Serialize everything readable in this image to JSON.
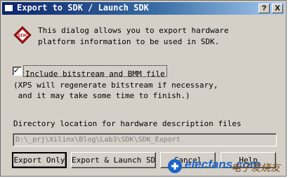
{
  "window": {
    "title": "Export to SDK / Launch SDK",
    "help_glyph": "?",
    "close_glyph": "X"
  },
  "icons": {
    "sdk_logo_text": "SDK",
    "checkbox_mark": "✓"
  },
  "description": {
    "line1": "This dialog allows you to export hardware",
    "line2": "platform information to be used in SDK."
  },
  "include_bitstream": {
    "label": "Include bitstream and BMM file",
    "checked": true
  },
  "note": {
    "line1": "(XPS will regenerate bitstream if necessary,",
    "line2": " and it may take some time to finish.)"
  },
  "directory": {
    "label": "Directory location for hardware description files",
    "value": "D:\\_prj\\Xilinx\\Blog\\Lab3\\SDK\\SDK_Export"
  },
  "buttons": {
    "export_only": "Export Only",
    "export_launch": "Export & Launch SDK",
    "cancel": "Cancel",
    "help": "Help"
  },
  "watermark": {
    "brand": "elecfans.com",
    "chinese": "电子发烧友"
  },
  "colors": {
    "titlebar_start": "#0a246a",
    "titlebar_end": "#a6caf0",
    "dialog_bg": "#d4d0c8",
    "sdk_red": "#b01818"
  }
}
